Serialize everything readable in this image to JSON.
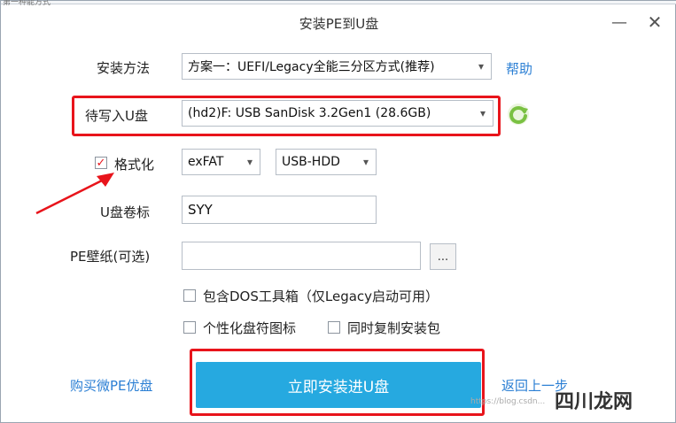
{
  "window": {
    "title": "安装PE到U盘",
    "top_fragment": "第一种能方式",
    "minimize": "—",
    "close": "✕"
  },
  "install_method": {
    "label": "安装方法",
    "value": "方案一：UEFI/Legacy全能三分区方式(推荐)",
    "help": "帮助"
  },
  "target_usb": {
    "label": "待写入U盘",
    "value": "(hd2)F: USB  SanDisk 3.2Gen1 (28.6GB)"
  },
  "format": {
    "label": "格式化",
    "checked": true,
    "filesystem": "exFAT",
    "mode": "USB-HDD"
  },
  "volume_label": {
    "label": "U盘卷标",
    "value": "SYY"
  },
  "wallpaper": {
    "label": "PE壁纸(可选)",
    "value": "",
    "browse": "..."
  },
  "options": {
    "dos_tools": "包含DOS工具箱（仅Legacy启动可用）",
    "custom_icon": "个性化盘符图标",
    "copy_package": "同时复制安装包"
  },
  "footer": {
    "buy_link": "购买微PE优盘",
    "install_button": "立即安装进U盘",
    "back_link": "返回上一步"
  },
  "watermark": {
    "text": "四川龙网",
    "small": "https://blog.csdn..."
  },
  "colors": {
    "accent": "#26a9e0",
    "link": "#2b7fd4",
    "highlight": "#e8141b",
    "refresh": "#7ac142"
  }
}
